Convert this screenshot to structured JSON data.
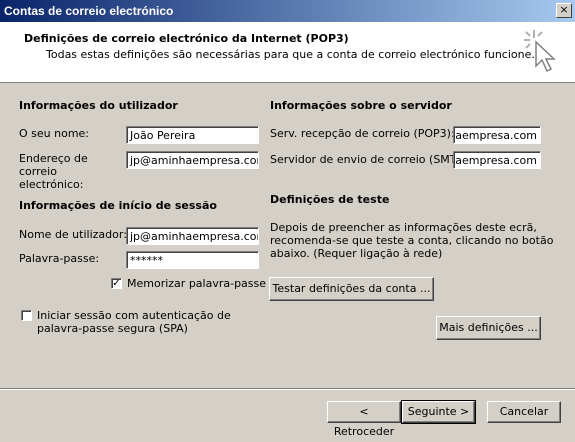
{
  "window": {
    "title": "Contas de correio electrónico",
    "close_glyph": "×"
  },
  "header": {
    "title": "Definições de correio electrónico da Internet (POP3)",
    "subtitle": "Todas estas definições são necessárias para que a conta de correio electrónico funcione."
  },
  "user_info": {
    "heading": "Informações do utilizador",
    "name_label": "O seu nome:",
    "name_value": "João Pereira",
    "email_label": "Endereço de correio electrónico:",
    "email_value": "jp@aminhaempresa.com"
  },
  "logon_info": {
    "heading": "Informações de início de sessão",
    "username_label": "Nome de utilizador:",
    "username_value": "jp@aminhaempresa.com",
    "password_label": "Palavra-passe:",
    "password_value": "******",
    "remember_label": "Memorizar palavra-passe",
    "remember_checked": true,
    "spa_label_line1": "Iniciar sessão com autenticação de",
    "spa_label_line2": "palavra-passe segura (SPA)",
    "spa_checked": false
  },
  "server_info": {
    "heading": "Informações sobre o servidor",
    "incoming_label": "Serv. recepção de correio (POP3):",
    "incoming_value": "mail.aminhaempresa.com",
    "outgoing_label": "Servidor de envio de correio (SMTP):",
    "outgoing_value": "mail.aminhaempresa.com"
  },
  "test": {
    "heading": "Definições de teste",
    "description_line1": "Depois de preencher as informações deste ecrã,",
    "description_line2": "recomenda-se que teste a conta, clicando no botão",
    "description_line3": "abaixo. (Requer ligação à rede)",
    "test_button": "Testar definições da conta ..."
  },
  "more_settings_button": "Mais definições ...",
  "footer": {
    "back_button": "< Retroceder",
    "next_button": "Seguinte >",
    "cancel_button": "Cancelar"
  },
  "icons": {
    "wizard": "cursor-sparkle-icon",
    "check": "checkmark-icon"
  }
}
